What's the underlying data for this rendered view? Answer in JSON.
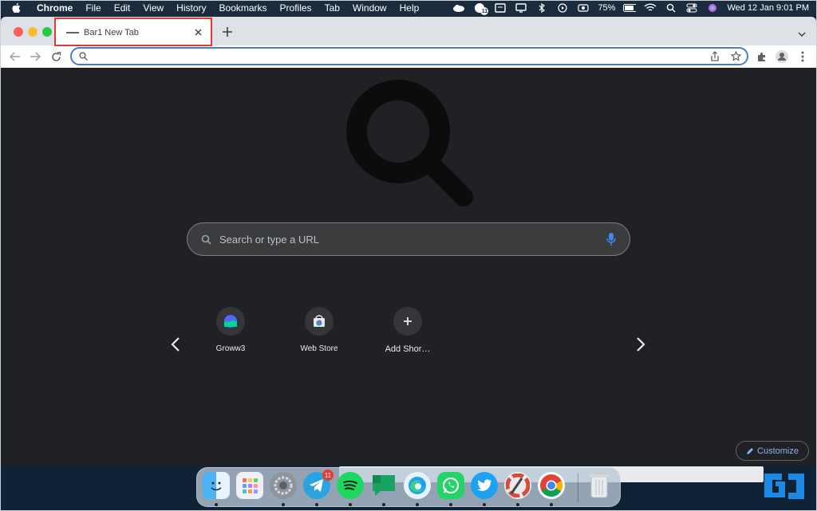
{
  "menubar": {
    "items": [
      "Chrome",
      "File",
      "Edit",
      "View",
      "History",
      "Bookmarks",
      "Profiles",
      "Tab",
      "Window",
      "Help"
    ],
    "battery": "75%",
    "clock": "Wed 12 Jan  9:01 PM",
    "badge_count": "11"
  },
  "browser": {
    "tab_title": "Bar1 New Tab",
    "omnibox_value": ""
  },
  "ntp": {
    "search_placeholder": "Search or type a URL",
    "shortcuts": [
      {
        "label": "Groww3",
        "icon": "groww-icon"
      },
      {
        "label": "Web Store",
        "icon": "web-store-icon"
      },
      {
        "label": "Add Shor…",
        "icon": "plus-icon"
      }
    ],
    "customize_label": "Customize"
  },
  "dock": {
    "apps": [
      "Finder",
      "Launchpad",
      "System Preferences",
      "Telegram",
      "Spotify",
      "Google Chat",
      "Edge",
      "WhatsApp",
      "Twitter",
      "Pages",
      "Chrome",
      "Trash"
    ],
    "telegram_badge": "11"
  },
  "colors": {
    "accent": "#4a7fbf",
    "ntp_bg": "#202124",
    "highlight": "#e53935",
    "customize_text": "#8ab4f8"
  }
}
